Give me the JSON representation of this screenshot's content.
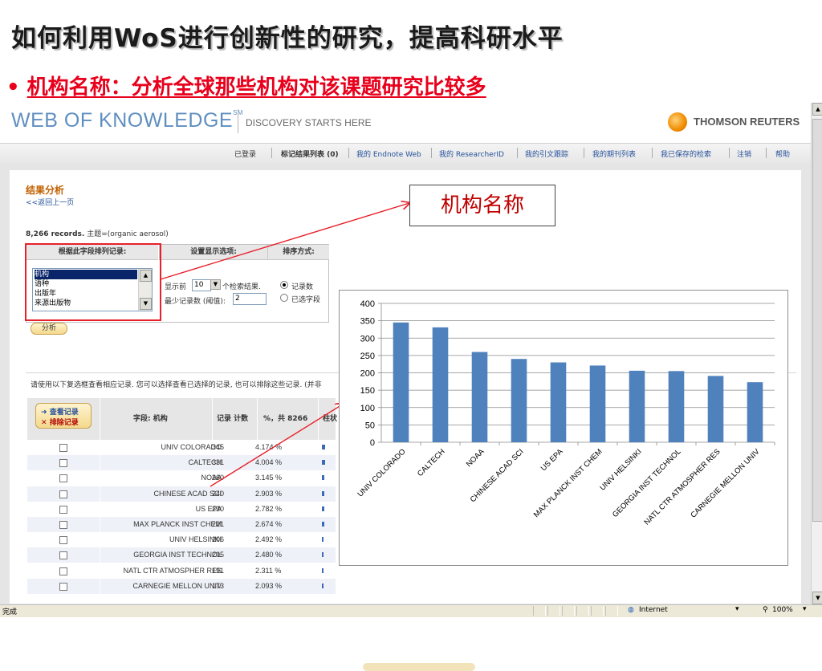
{
  "slide": {
    "title": "如何利用WoS进行创新性的研究，提高科研水平",
    "bullet": "机构名称：分析全球那些机构对该课题研究比较多"
  },
  "header": {
    "logo": "WEB OF KNOWLEDGE",
    "logo_mark": "SM",
    "tagline": "DISCOVERY STARTS HERE",
    "brand": "THOMSON REUTERS"
  },
  "nav": {
    "items": [
      "已登录",
      "标记结果列表 (0)",
      "我的 Endnote Web",
      "我的 ResearcherID",
      "我的引文跟踪",
      "我的期刊列表",
      "我已保存的检索",
      "注销",
      "帮助"
    ]
  },
  "results": {
    "title": "结果分析",
    "back": "<<返回上一页",
    "records": "8,266 records.",
    "query": "主题=(organic aerosol)",
    "col1": "根据此字段排列记录:",
    "col2": "设置显示选项:",
    "col3": "排序方式:",
    "fields": [
      "机构",
      "语种",
      "出版年",
      "来源出版物"
    ],
    "show_label": "显示前",
    "show_value": "10",
    "show_suffix": "个检索结果.",
    "min_label": "最少记录数 (阈值):",
    "min_value": "2",
    "sort1": "记录数",
    "sort2": "已选字段",
    "analyze": "分析",
    "instruction": "请使用以下复选框查看相应记录. 您可以选择查看已选择的记录, 也可以排除这些记录. (并非"
  },
  "table": {
    "view_btn": "查看记录",
    "exclude_btn": "排除记录",
    "h_field": "字段: 机构",
    "h_count": "记录 计数",
    "h_pct": "%，共 8266",
    "h_bar": "柱状",
    "rows": [
      {
        "name": "UNIV COLORADO",
        "count": "345",
        "pct": "4.174 %"
      },
      {
        "name": "CALTECH",
        "count": "331",
        "pct": "4.004 %"
      },
      {
        "name": "NOAA",
        "count": "260",
        "pct": "3.145 %"
      },
      {
        "name": "CHINESE ACAD SCI",
        "count": "240",
        "pct": "2.903 %"
      },
      {
        "name": "US EPA",
        "count": "230",
        "pct": "2.782 %"
      },
      {
        "name": "MAX PLANCK INST CHEM",
        "count": "221",
        "pct": "2.674 %"
      },
      {
        "name": "UNIV HELSINKI",
        "count": "206",
        "pct": "2.492 %"
      },
      {
        "name": "GEORGIA INST TECHNOL",
        "count": "205",
        "pct": "2.480 %"
      },
      {
        "name": "NATL CTR ATMOSPHER RES",
        "count": "191",
        "pct": "2.311 %"
      },
      {
        "name": "CARNEGIE MELLON UNIV",
        "count": "173",
        "pct": "2.093 %"
      }
    ]
  },
  "annotation": "机构名称",
  "status": {
    "done": "完成",
    "zone": "Internet",
    "zoom": "100%"
  },
  "colors": {
    "accent_red": "#e8001c",
    "bar_blue": "#4f81bd"
  },
  "chart_data": {
    "type": "bar",
    "categories": [
      "UNIV COLORADO",
      "CALTECH",
      "NOAA",
      "CHINESE ACAD SCI",
      "US EPA",
      "MAX PLANCK INST CHEM",
      "UNIV HELSINKI",
      "GEORGIA INST TECHNOL",
      "NATL CTR ATMOSPHER RES",
      "CARNEGIE MELLON UNIV"
    ],
    "values": [
      345,
      331,
      260,
      240,
      230,
      221,
      206,
      205,
      191,
      173
    ],
    "ylim": [
      0,
      400
    ],
    "yticks": [
      0,
      50,
      100,
      150,
      200,
      250,
      300,
      350,
      400
    ],
    "grid": true,
    "legend": "none"
  }
}
